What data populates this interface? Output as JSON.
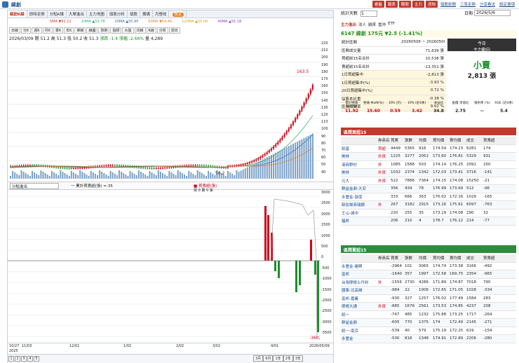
{
  "app": {
    "title": "緯創"
  },
  "top_buttons": [
    "看盤",
    "報表",
    "贈閱",
    "主力",
    "咨詢"
  ],
  "top_links": [
    "個股新聞",
    "三率走勢",
    "分享看法",
    "設定選項"
  ],
  "tabs": [
    {
      "label": "緯創K線",
      "active": true
    },
    {
      "label": "即時走勢"
    },
    {
      "label": "分點K線"
    },
    {
      "label": "大單進出"
    },
    {
      "label": "主力地圖"
    },
    {
      "label": "個股分析"
    },
    {
      "label": "個股"
    },
    {
      "label": "籌碼"
    },
    {
      "label": "月營收"
    },
    {
      "label": "",
      "badge": "設定"
    }
  ],
  "ma_legend": [
    "5MA ▼52.12",
    "10MA ▲53.78",
    "20MA ▲55.95",
    "60MA ▼54.40",
    "120MA ▲55.00",
    "40MA ▲55.18"
  ],
  "chart_tools": [
    "日線",
    "分K",
    "週K",
    "月K",
    "季K",
    "年K",
    "單線",
    "線圖",
    "技術",
    "指標",
    "大盤",
    "均線",
    "K線",
    "分析",
    "前日"
  ],
  "chart_info": {
    "date": "2026/03/09",
    "open": "開 51.2",
    "high": "高 51.3",
    "low": "低 50.2",
    "close": "收 51.3",
    "change": "漲跌 -1.4",
    "pct": "漲幅 -2.66%",
    "vol": "量 4,289"
  },
  "price_axis": [
    "220",
    "210",
    "200",
    "190",
    "180",
    "170",
    "160",
    "150",
    "140",
    "130",
    "120",
    "110",
    "100",
    "90",
    "80",
    "70",
    "60",
    "50",
    "40"
  ],
  "price_tags": {
    "last": "163.5",
    "low": "50.2"
  },
  "indicator": {
    "select": "分點進出",
    "legend1": "一 累計買賣超(張) =-35",
    "legend2": "■ 買賣超(張)",
    "legend3": "買 0 賣 0 張"
  },
  "sub_axis": [
    "3000",
    "2500",
    "2000",
    "1500",
    "1000",
    "500",
    "0",
    "-500",
    "-1000",
    "-1500",
    "-2000",
    "-2500",
    "-3000",
    "-3500"
  ],
  "sub_tag": "-3602",
  "x_axis": [
    "10/27",
    "11/03",
    "12/01",
    "1/02",
    "2/02",
    "3/02",
    "4/01",
    "2026/05/09"
  ],
  "x_year": "2025",
  "bottom_pages": [
    "1",
    "2",
    "3",
    "4",
    "5"
  ],
  "bottom_buttons": [
    "3月",
    "6月",
    "1年",
    "2年",
    "3年"
  ],
  "chart_data": {
    "type": "line",
    "x": [
      "10/27",
      "11/03",
      "12/01",
      "1/02",
      "2/02",
      "3/02",
      "4/01",
      "2026/05/09"
    ],
    "values": [
      50,
      51,
      50,
      52,
      53,
      55,
      100,
      175.5
    ],
    "ylim": [
      40,
      220
    ]
  },
  "right": {
    "days_label": "統計天數",
    "days": "1",
    "date_label": "日期",
    "date": "2026/5/6",
    "subtabs": [
      "主力進出",
      "法人",
      "融資",
      "當沖",
      "ETF"
    ],
    "stock_line": "6147 緯創  175元  ▼2.5 (-1.41%)",
    "stats": [
      [
        "統計區間",
        "20260506 ~ 20260506"
      ],
      [
        "區間成交量",
        "71,639 張"
      ],
      [
        "買超前15名合計",
        "10,538 張"
      ],
      [
        "賣超前15名合計",
        "-13,351 張"
      ],
      [
        "1日買超集中",
        "-2,813 張"
      ],
      [
        "1日買超集中(%)",
        "-3.93 %"
      ],
      [
        "20日買超集中(%)",
        "0.72 %"
      ],
      [
        "佔股本比重",
        "-0.38 %"
      ],
      [
        "區間周轉率",
        "9.62 %"
      ]
    ],
    "big": {
      "top": "今日",
      "sub": "主力動向",
      "label": "小賣",
      "value": "2,813 張"
    },
    "fin_hdr": [
      "累計營收 YoY(%)",
      "營收 MoM(%)",
      "EPS (元)",
      "EPS (近4季)",
      "本益比",
      "股價 淨值比",
      "殖利率 (%)",
      "ROE (近4季)"
    ],
    "fin_val": [
      "11.92",
      "15.60",
      "0.59",
      "3.42",
      "34.8",
      "2.75",
      "--",
      "5.4"
    ],
    "buy_title": "區間買超15",
    "buy_filter": "重新參數",
    "buy_sel": "區間買超15",
    "cols": [
      "券商名稱",
      "買賣",
      "張數",
      "均價",
      "買均價",
      "賣均價",
      "成交",
      "買賣超"
    ],
    "buy_rows": [
      [
        "凱基",
        "買超",
        "4449",
        "5365",
        "916",
        "174.54",
        "174.23",
        "6281",
        "174"
      ],
      [
        "美林",
        "外資",
        "1225",
        "3277",
        "2052",
        "173.60",
        "176.81",
        "5329",
        "931"
      ],
      [
        "港商野村",
        "外",
        "1085",
        "1588",
        "503",
        "174.14",
        "176.25",
        "2091",
        "200"
      ],
      [
        "美林",
        "外資",
        "1032",
        "2374",
        "1342",
        "172.03",
        "173.41",
        "3716",
        "-141"
      ],
      [
        "元大",
        "外資",
        "522",
        "7886",
        "7364",
        "174.15",
        "174.08",
        "15250",
        "-21"
      ],
      [
        "群益金鼎-大安",
        "",
        "356",
        "434",
        "78",
        "176.99",
        "173.69",
        "512",
        "-96"
      ],
      [
        "永豐金-敦南",
        "",
        "333",
        "666",
        "363",
        "176.02",
        "172.16",
        "1029",
        "-165"
      ],
      [
        "新加坡商瑞銀",
        "外",
        "267",
        "3182",
        "2915",
        "173.16",
        "175.61",
        "6097",
        "-763"
      ],
      [
        "王山-城中",
        "",
        "220",
        "255",
        "35",
        "173.19",
        "174.08",
        "290",
        "32"
      ],
      [
        "福邦",
        "",
        "206",
        "210",
        "4",
        "178.7",
        "176.12",
        "214",
        "-77"
      ]
    ],
    "sell_title": "區間賣超15",
    "sell_filter": "重新參數",
    "sell_sel": "區間賣超15",
    "sell_rows": [
      [
        "永豐金-建興",
        "",
        "-2964",
        "101",
        "3065",
        "174.74",
        "173.38",
        "3166",
        "-492"
      ],
      [
        "富邦",
        "",
        "-1640",
        "357",
        "1997",
        "172.58",
        "169.75",
        "2354",
        "-965"
      ],
      [
        "台灣摩根士丹利",
        "外",
        "-1556",
        "2730",
        "4286",
        "171.89",
        "174.87",
        "7018",
        "790"
      ],
      [
        "國泰-北高雄",
        "",
        "-984",
        "22",
        "1006",
        "172.65",
        "171.05",
        "1028",
        "-334"
      ],
      [
        "富邦-嘉義",
        "",
        "-930",
        "327",
        "1257",
        "176.02",
        "177.49",
        "1584",
        "283"
      ],
      [
        "摩根大通",
        "外資",
        "-885",
        "1676",
        "2561",
        "173.53",
        "174.85",
        "4237",
        "208"
      ],
      [
        "統一",
        "",
        "-747",
        "485",
        "1232",
        "175.88",
        "173.25",
        "1717",
        "-264"
      ],
      [
        "群益金鼎",
        "",
        "-605",
        "770",
        "1375",
        "174",
        "172.49",
        "2145",
        "-271"
      ],
      [
        "統一-南京",
        "",
        "-539",
        "40",
        "579",
        "175.19",
        "172.25",
        "619",
        "-154"
      ],
      [
        "永豐金",
        "",
        "-530",
        "818",
        "1348",
        "174.91",
        "172.89",
        "2206",
        "-280"
      ]
    ]
  }
}
